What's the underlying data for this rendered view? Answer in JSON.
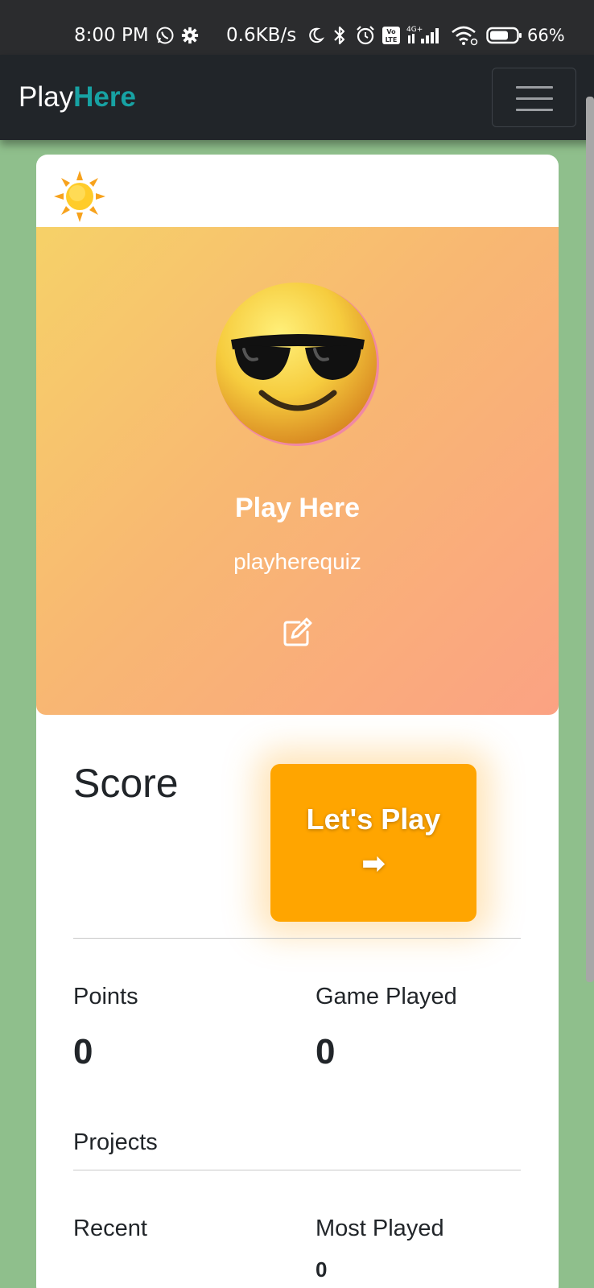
{
  "status_bar": {
    "time": "8:00 PM",
    "network_speed": "0.6KB/s",
    "battery_percent": "66%",
    "icons": [
      "whatsapp-icon",
      "gear-icon",
      "moon-icon",
      "bluetooth-icon",
      "alarm-icon",
      "volte-icon",
      "signal-icon",
      "wifi-icon",
      "battery-icon"
    ],
    "volte_label": "Vo\nLTE",
    "network_type": "4G+",
    "battery_level": 0.66
  },
  "navbar": {
    "brand_part1": "Play",
    "brand_part2": "Here",
    "brand_accent_color": "#17a2a3",
    "menu_icon": "hamburger-icon"
  },
  "profile": {
    "theme_icon": "sun-icon",
    "avatar_icon": "sunglasses-emoji-icon",
    "name": "Play Here",
    "handle": "playherequiz",
    "edit_icon": "edit-icon"
  },
  "score_section": {
    "title": "Score",
    "play_button_label": "Let's Play",
    "play_button_arrow": "➡",
    "play_button_color": "#ffa500"
  },
  "stats": {
    "points_label": "Points",
    "points_value": "0",
    "games_label": "Game Played",
    "games_value": "0"
  },
  "projects": {
    "title": "Projects",
    "recent_label": "Recent",
    "most_played_label": "Most Played",
    "most_played_value": "0"
  }
}
